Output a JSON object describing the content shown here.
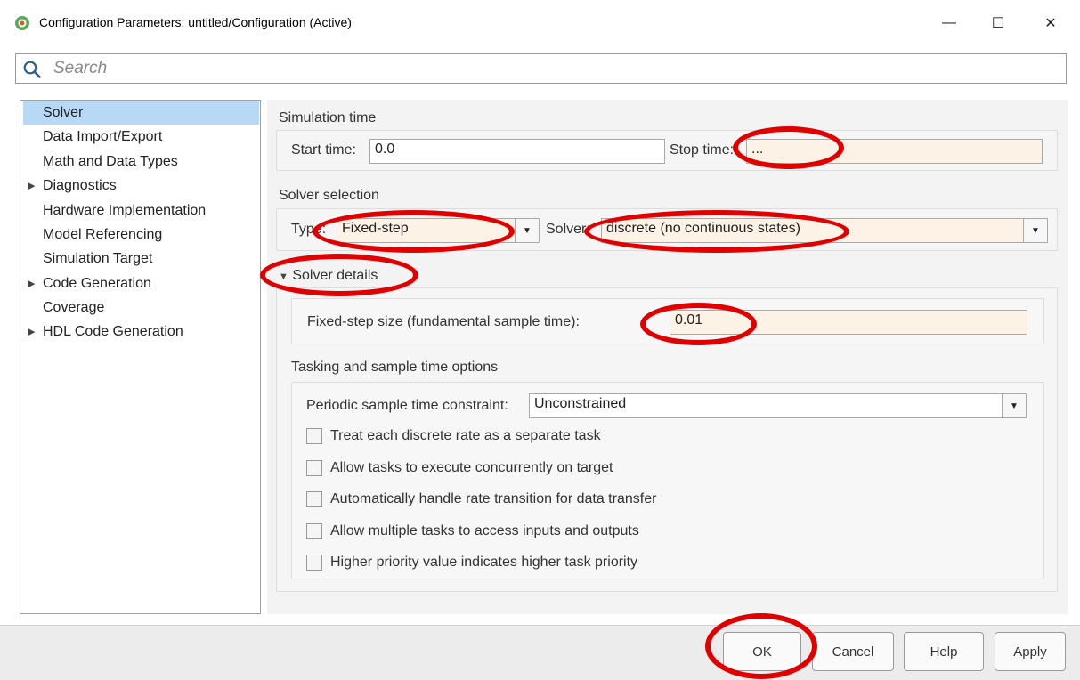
{
  "window": {
    "title": "Configuration Parameters: untitled/Configuration (Active)",
    "minimize_glyph": "—",
    "maximize_glyph": "☐",
    "close_glyph": "✕"
  },
  "search": {
    "placeholder": "Search"
  },
  "nav": {
    "items": [
      {
        "label": "Solver",
        "selected": true,
        "expandable": false
      },
      {
        "label": "Data Import/Export",
        "expandable": false
      },
      {
        "label": "Math and Data Types",
        "expandable": false
      },
      {
        "label": "Diagnostics",
        "expandable": true
      },
      {
        "label": "Hardware Implementation",
        "expandable": false
      },
      {
        "label": "Model Referencing",
        "expandable": false
      },
      {
        "label": "Simulation Target",
        "expandable": false
      },
      {
        "label": "Code Generation",
        "expandable": true
      },
      {
        "label": "Coverage",
        "expandable": false
      },
      {
        "label": "HDL Code Generation",
        "expandable": true
      }
    ],
    "expand_glyph": "▶"
  },
  "simulation_time": {
    "heading": "Simulation time",
    "start_label": "Start time:",
    "start_value": "0.0",
    "stop_label": "Stop time:",
    "stop_value": "..."
  },
  "solver_selection": {
    "heading": "Solver selection",
    "type_label": "Type:",
    "type_value": "Fixed-step",
    "solver_label": "Solver:",
    "solver_value": "discrete (no continuous states)",
    "dropdown_glyph": "▼"
  },
  "solver_details": {
    "heading": "Solver details",
    "toggle_glyph": "▼",
    "step_label": "Fixed-step size (fundamental sample time):",
    "step_value": "0.01"
  },
  "tasking": {
    "heading": "Tasking and sample time options",
    "constraint_label": "Periodic sample time constraint:",
    "constraint_value": "Unconstrained",
    "checkboxes": [
      {
        "label": "Treat each discrete rate as a separate task",
        "checked": false
      },
      {
        "label": "Allow tasks to execute concurrently on target",
        "checked": false
      },
      {
        "label": "Automatically handle rate transition for data transfer",
        "checked": false
      },
      {
        "label": "Allow multiple tasks to access inputs and outputs",
        "checked": false
      },
      {
        "label": "Higher priority value indicates higher task priority",
        "checked": false
      }
    ]
  },
  "buttons": {
    "ok": "OK",
    "cancel": "Cancel",
    "help": "Help",
    "apply": "Apply"
  },
  "colors": {
    "annotation": "#e00000",
    "selected_nav": "#b7d9f5",
    "tinted_field": "#fdf2e6"
  }
}
